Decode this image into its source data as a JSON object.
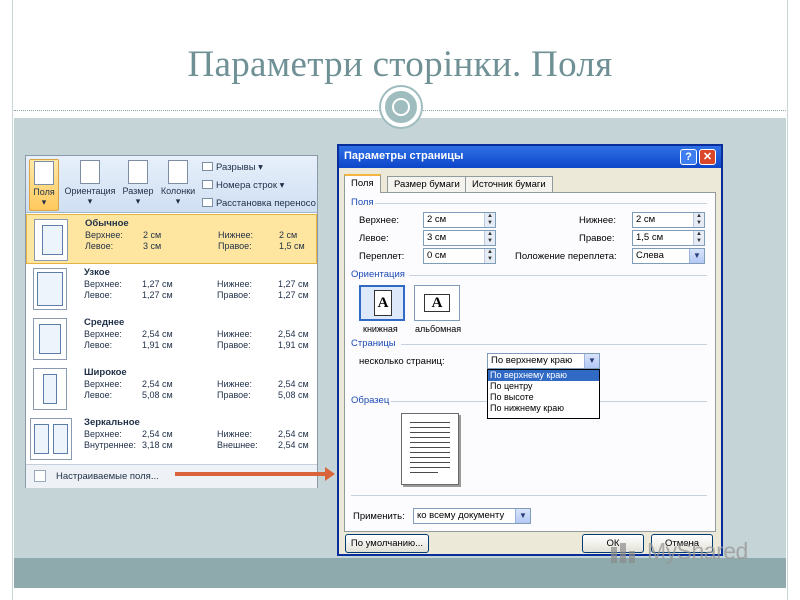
{
  "slide": {
    "title": "Параметри сторінки. Поля"
  },
  "ribbon": {
    "buttons": [
      {
        "label": "Поля",
        "arrow": "▾"
      },
      {
        "label": "Ориентация",
        "arrow": "▾"
      },
      {
        "label": "Размер",
        "arrow": "▾"
      },
      {
        "label": "Колонки",
        "arrow": "▾"
      }
    ],
    "small_buttons": [
      {
        "label": "Разрывы ▾"
      },
      {
        "label": "Номера строк ▾"
      },
      {
        "label": "Расстановка переносов"
      }
    ]
  },
  "margins_gallery": {
    "items": [
      {
        "name": "Обычное",
        "k1": "Верхнее:",
        "v1": "2 см",
        "k2": "Нижнее:",
        "v2": "2 см",
        "k3": "Левое:",
        "v3": "3 см",
        "k4": "Правое:",
        "v4": "1,5 см"
      },
      {
        "name": "Узкое",
        "k1": "Верхнее:",
        "v1": "1,27 см",
        "k2": "Нижнее:",
        "v2": "1,27 см",
        "k3": "Левое:",
        "v3": "1,27 см",
        "k4": "Правое:",
        "v4": "1,27 см"
      },
      {
        "name": "Среднее",
        "k1": "Верхнее:",
        "v1": "2,54 см",
        "k2": "Нижнее:",
        "v2": "2,54 см",
        "k3": "Левое:",
        "v3": "1,91 см",
        "k4": "Правое:",
        "v4": "1,91 см"
      },
      {
        "name": "Широкое",
        "k1": "Верхнее:",
        "v1": "2,54 см",
        "k2": "Нижнее:",
        "v2": "2,54 см",
        "k3": "Левое:",
        "v3": "5,08 см",
        "k4": "Правое:",
        "v4": "5,08 см"
      },
      {
        "name": "Зеркальное",
        "k1": "Верхнее:",
        "v1": "2,54 см",
        "k2": "Нижнее:",
        "v2": "2,54 см",
        "k3": "Внутреннее:",
        "v3": "3,18 см",
        "k4": "Внешнее:",
        "v4": "2,54 см"
      }
    ],
    "footer": "Настраиваемые поля..."
  },
  "dialog": {
    "title": "Параметры страницы",
    "help_glyph": "?",
    "close_glyph": "✕",
    "tabs": [
      "Поля",
      "Размер бумаги",
      "Источник бумаги"
    ],
    "fields_section": "Поля",
    "top_label": "Верхнее:",
    "top_value": "2 см",
    "bottom_label": "Нижнее:",
    "bottom_value": "2 см",
    "left_label": "Левое:",
    "left_value": "3 см",
    "right_label": "Правое:",
    "right_value": "1,5 см",
    "gutter_label": "Переплет:",
    "gutter_value": "0 см",
    "gutter_pos_label": "Положение переплета:",
    "gutter_pos_value": "Слева",
    "orientation_section": "Ориентация",
    "portrait_label": "книжная",
    "landscape_label": "альбомная",
    "orient_letter": "A",
    "pages_section": "Страницы",
    "multiple_pages_label": "несколько страниц:",
    "multiple_pages_value": "По верхнему краю",
    "dropdown_options": [
      "По верхнему краю",
      "По центру",
      "По высоте",
      "По нижнему краю"
    ],
    "preview_section": "Образец",
    "apply_label": "Применить:",
    "apply_value": "ко всему документу",
    "default_button": "По умолчанию...",
    "ok_button": "ОК",
    "cancel_button": "Отмена"
  },
  "watermark": {
    "text": "MyShared"
  }
}
